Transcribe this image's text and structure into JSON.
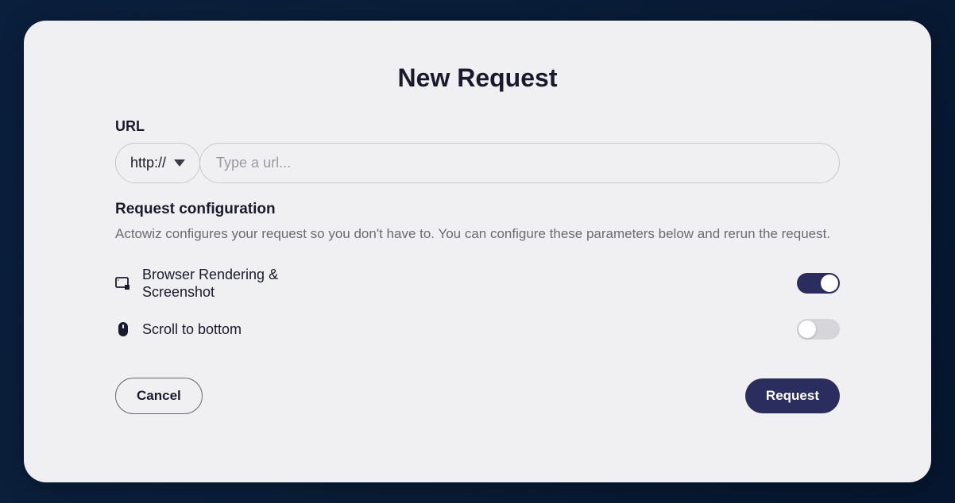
{
  "modal": {
    "title": "New Request",
    "url": {
      "label": "URL",
      "protocol_selected": "http://",
      "placeholder": "Type a url...",
      "value": ""
    },
    "config": {
      "title": "Request configuration",
      "description": "Actowiz configures your request so you don't have to. You can configure these parameters below and rerun the request.",
      "options": [
        {
          "icon": "browser-screenshot-icon",
          "label": "Browser Rendering & Screenshot",
          "enabled": true
        },
        {
          "icon": "mouse-icon",
          "label": "Scroll to bottom",
          "enabled": false
        }
      ]
    },
    "buttons": {
      "cancel": "Cancel",
      "submit": "Request"
    }
  },
  "colors": {
    "accent": "#2b2d5e",
    "text": "#1a1a2e",
    "muted": "#6a6a78",
    "border": "#c8c8cc",
    "surface": "#f0f0f2"
  }
}
